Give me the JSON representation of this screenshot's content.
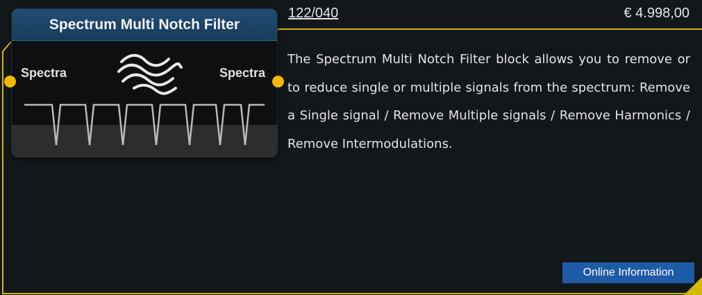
{
  "product": {
    "sku": "122/040",
    "price": "€ 4.998,00",
    "description": "The Spectrum Multi Notch Filter block allows you to remove or to reduce single or multiple signals from the spectrum: Remove a Single signal / Remove Multiple signals / Remove Harmonics / Remove Intermodulations."
  },
  "block": {
    "title": "Spectrum Multi Notch Filter",
    "input_label": "Spectra",
    "output_label": "Spectra",
    "icon": "multi-notch-filter-icon"
  },
  "actions": {
    "online_info_label": "Online Information"
  },
  "colors": {
    "accent_yellow": "#e0c200",
    "port_dot": "#f5b800",
    "title_bar": "#1f4d73",
    "button": "#1f5aa6",
    "background": "#12171a"
  }
}
